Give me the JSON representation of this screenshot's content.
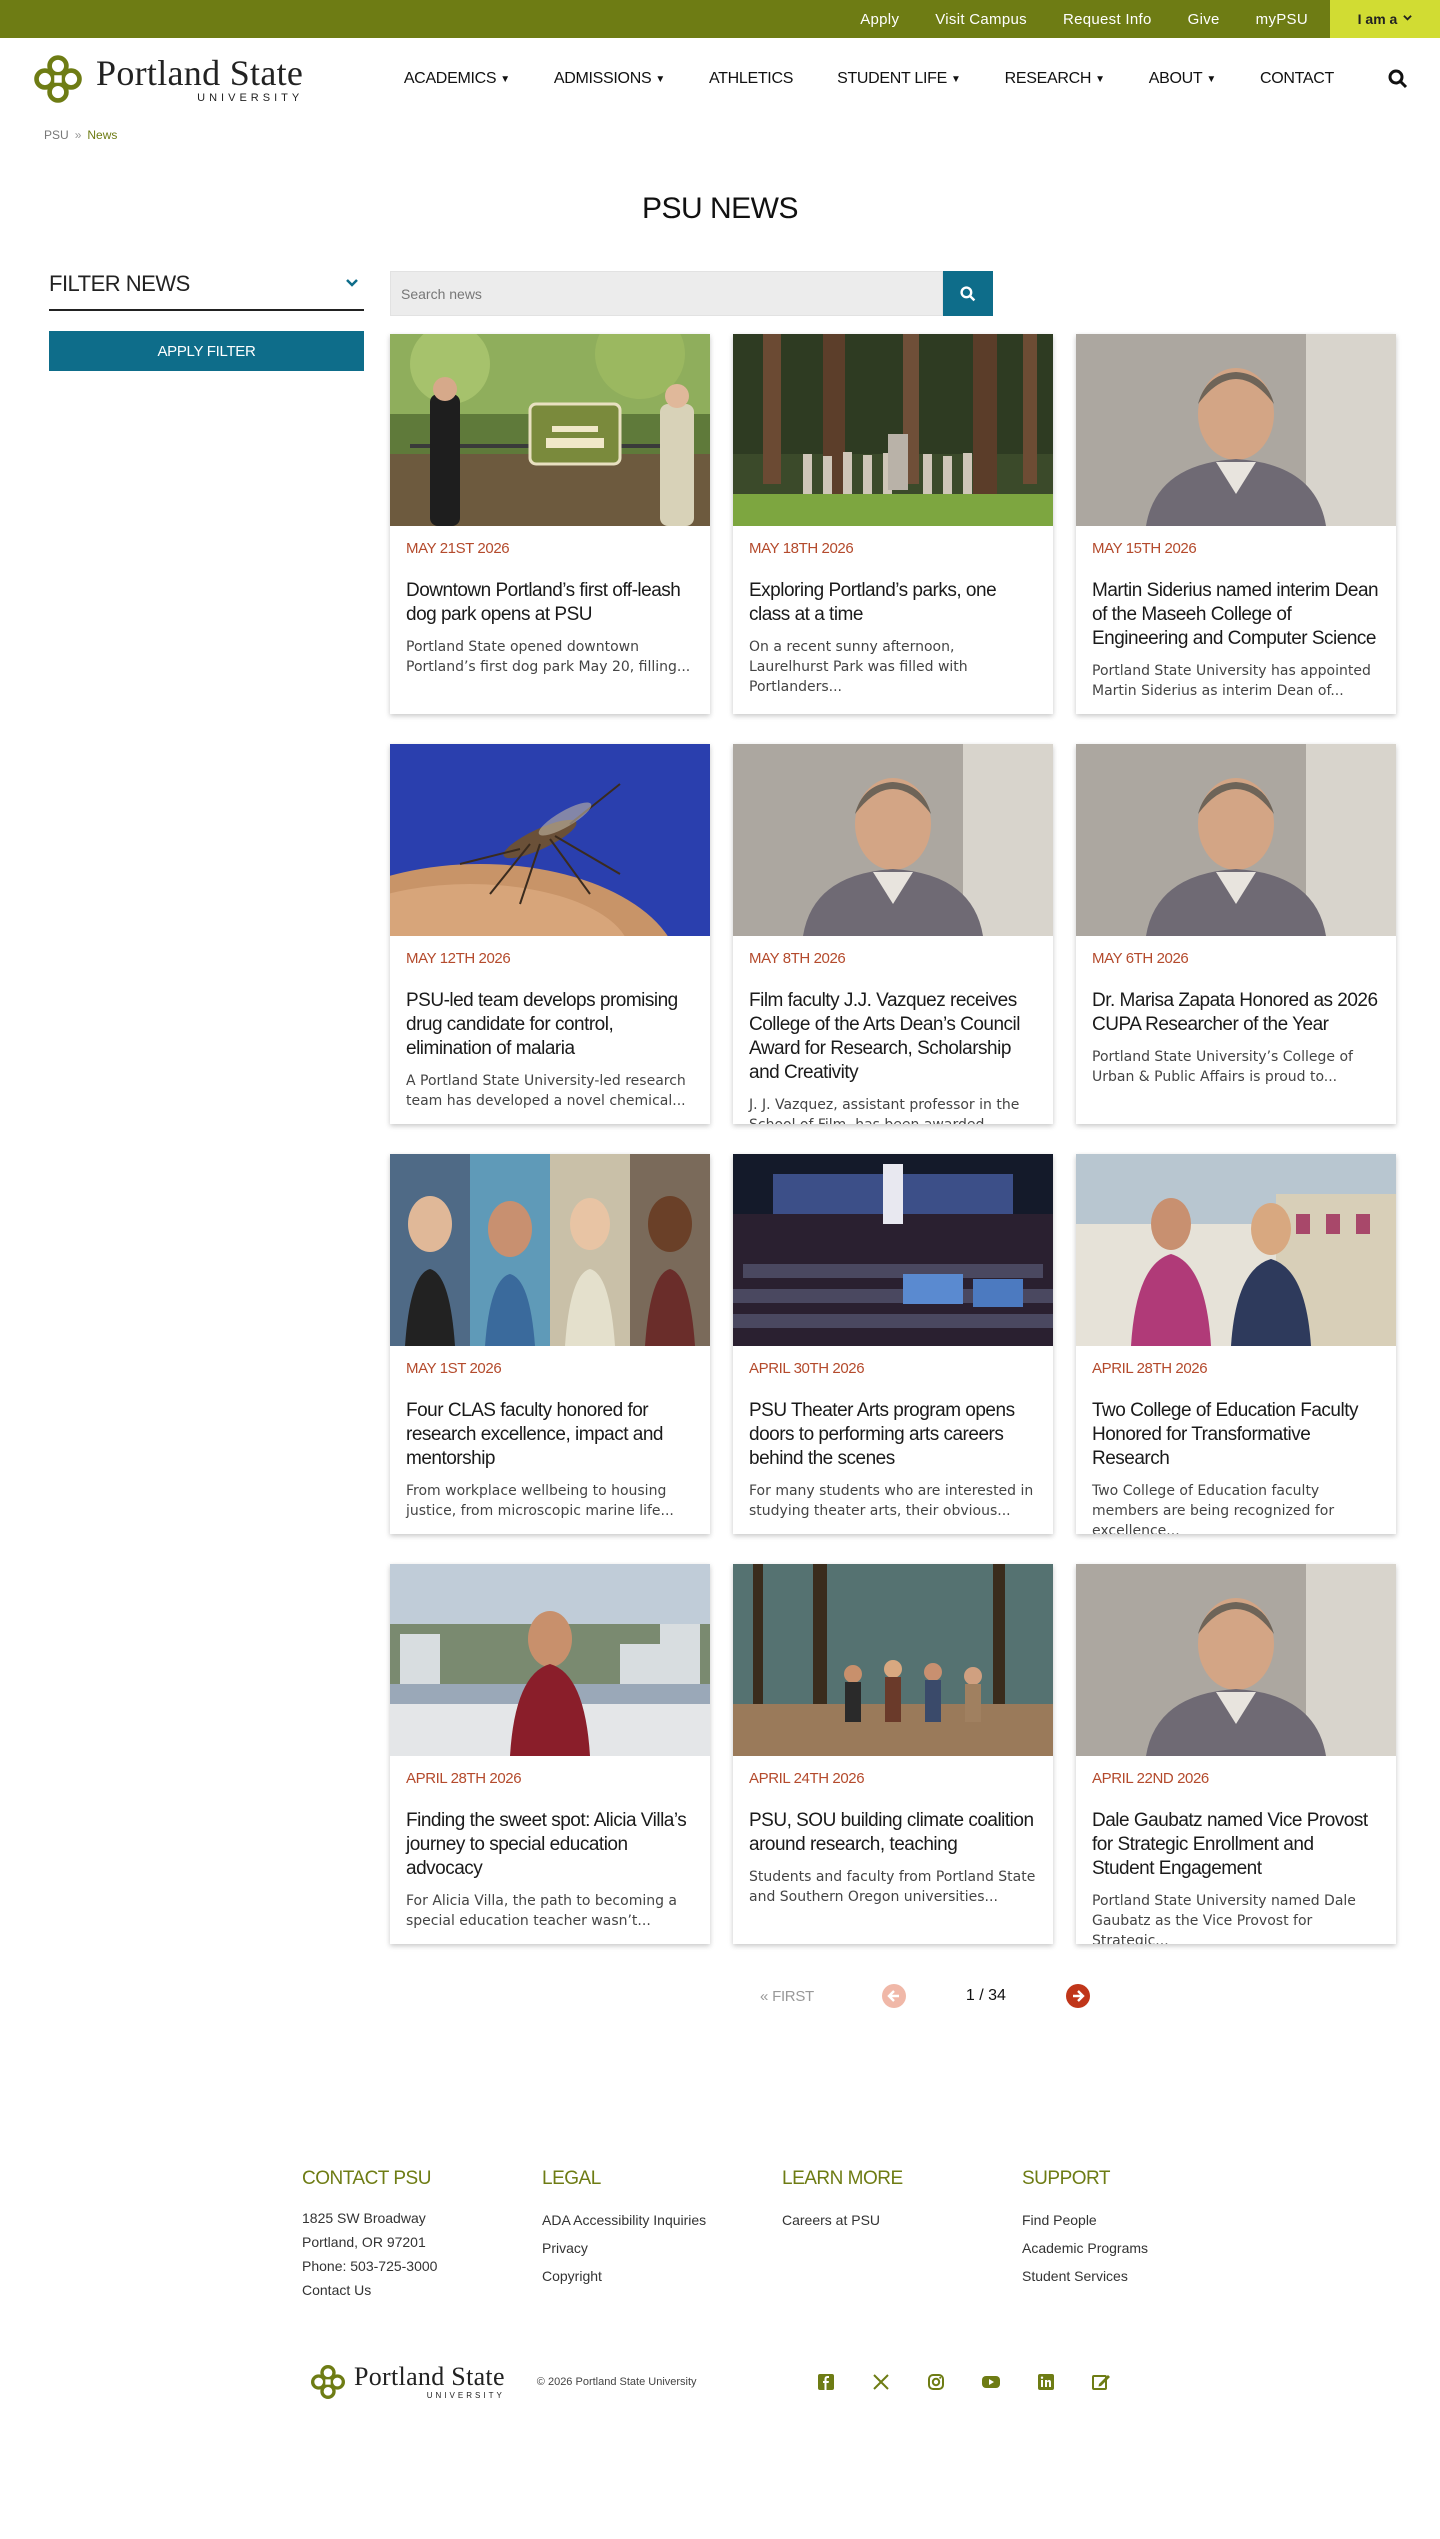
{
  "utility": {
    "links": [
      "Apply",
      "Visit Campus",
      "Request Info",
      "Give",
      "myPSU"
    ],
    "iama_label": "I am a"
  },
  "header": {
    "logo_main": "Portland State",
    "logo_sub": "UNIVERSITY",
    "nav": [
      {
        "label": "Academics",
        "has_menu": true
      },
      {
        "label": "Admissions",
        "has_menu": true
      },
      {
        "label": "Athletics",
        "has_menu": false
      },
      {
        "label": "Student Life",
        "has_menu": true
      },
      {
        "label": "Research",
        "has_menu": true
      },
      {
        "label": "About",
        "has_menu": true
      },
      {
        "label": "Contact",
        "has_menu": false
      }
    ]
  },
  "breadcrumb": {
    "root": "PSU",
    "sep": "»",
    "current": "News"
  },
  "page": {
    "title": "PSU NEWS"
  },
  "filter": {
    "title": "FILTER NEWS",
    "apply_label": "APPLY FILTER"
  },
  "search": {
    "placeholder": "Search news",
    "value": ""
  },
  "articles": [
    {
      "date": "MAY 21ST 2026",
      "title": "Downtown Portland’s first off-leash dog park opens at PSU",
      "excerpt": "Portland State opened downtown Portland’s first dog park May 20, filling...",
      "image": "dog-park-photo"
    },
    {
      "date": "MAY 18TH 2026",
      "title": "Exploring Portland’s parks, one class at a time",
      "excerpt": "On a recent sunny afternoon, Laurelhurst Park was filled with Portlanders...",
      "image": "forest-class-photo"
    },
    {
      "date": "MAY 15TH 2026",
      "title": "Martin Siderius named interim Dean of the Maseeh College of Engineering and Computer Science",
      "excerpt": "Portland State University has appointed Martin Siderius as interim Dean of...",
      "image": "portrait-photo"
    },
    {
      "date": "MAY 12TH 2026",
      "title": "PSU-led team develops promising drug candidate for control, elimination of malaria",
      "excerpt": "A Portland State University-led research team has developed a novel chemical...",
      "image": "mosquito-photo"
    },
    {
      "date": "MAY 8TH 2026",
      "title": "Film faculty J.J. Vazquez receives College of the Arts Dean’s Council Award for Research, Scholarship and Creativity",
      "excerpt": "J. J. Vazquez, assistant professor in the School of Film, has been awarded...",
      "image": "portrait-photo"
    },
    {
      "date": "MAY 6TH 2026",
      "title": "Dr. Marisa Zapata Honored as 2026 CUPA Researcher of the Year",
      "excerpt": "Portland State University’s College of Urban & Public Affairs is proud to...",
      "image": "portrait-photo"
    },
    {
      "date": "MAY 1ST 2026",
      "title": "Four CLAS faculty honored for research excellence, impact and mentorship",
      "excerpt": "From workplace wellbeing to housing justice, from microscopic marine life...",
      "image": "faculty-collage-photo"
    },
    {
      "date": "APRIL 30TH 2026",
      "title": "PSU Theater Arts program opens doors to performing arts careers behind the scenes",
      "excerpt": "For many students who are interested in studying theater arts, their obvious...",
      "image": "theater-photo"
    },
    {
      "date": "APRIL 28TH 2026",
      "title": "Two College of Education Faculty Honored for Transformative Research",
      "excerpt": "Two College of Education faculty members are being recognized for excellence...",
      "image": "classroom-photo"
    },
    {
      "date": "APRIL 28TH 2026",
      "title": "Finding the sweet spot: Alicia Villa’s journey to special education advocacy",
      "excerpt": "For Alicia Villa, the path to becoming a special education teacher wasn’t...",
      "image": "balcony-photo"
    },
    {
      "date": "APRIL 24TH 2026",
      "title": "PSU, SOU building climate coalition around research, teaching",
      "excerpt": "Students and faculty from Portland State and Southern Oregon universities...",
      "image": "outdoor-group-photo"
    },
    {
      "date": "APRIL 22ND 2026",
      "title": "Dale Gaubatz named Vice Provost for Strategic Enrollment and Student Engagement",
      "excerpt": "Portland State University named Dale Gaubatz as the Vice Provost for Strategic...",
      "image": "portrait-photo"
    }
  ],
  "pagination": {
    "first_label": "FIRST",
    "first_prefix": "«",
    "page_count": "1 / 34"
  },
  "footer": {
    "columns": [
      {
        "title": "CONTACT PSU",
        "lines": [
          "1825 SW Broadway",
          "Portland, OR 97201",
          "Phone: 503-725-3000"
        ],
        "links": [
          "Contact Us"
        ]
      },
      {
        "title": "LEGAL",
        "lines": [],
        "links": [
          "ADA Accessibility Inquiries",
          "Privacy",
          "Copyright"
        ]
      },
      {
        "title": "LEARN MORE",
        "lines": [],
        "links": [
          "Careers at PSU"
        ]
      },
      {
        "title": "SUPPORT",
        "lines": [],
        "links": [
          "Find People",
          "Academic Programs",
          "Student Services"
        ]
      }
    ],
    "copyright": "© 2026 Portland State University",
    "social": [
      "facebook-icon",
      "x-icon",
      "instagram-icon",
      "youtube-icon",
      "linkedin-icon",
      "edit-icon"
    ]
  },
  "colors": {
    "brand_green": "#6e7c14",
    "accent_lime": "#d1dc33",
    "teal": "#0e6d8a",
    "date_red": "#b44a2c"
  }
}
